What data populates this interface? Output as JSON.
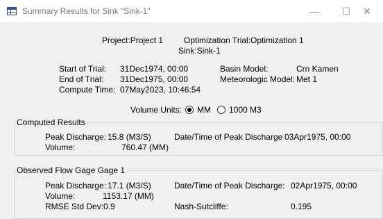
{
  "window": {
    "title": "Summary Results for Sink \"Sink-1\"",
    "minimize_glyph": "—",
    "maximize_glyph": "☐",
    "close_glyph": "✕"
  },
  "header": {
    "project_label": "Project:",
    "project_value": "Project 1",
    "trial_label": "Optimization Trial:",
    "trial_value": "Optimization 1",
    "sink_label": "Sink:",
    "sink_value": "Sink-1"
  },
  "info": {
    "start_label": "Start of Trial:",
    "start_value": "31Dec1974, 00:00",
    "end_label": "End of Trial:",
    "end_value": "31Dec1975, 00:00",
    "compute_label": "Compute Time:",
    "compute_value": "07May2023, 10:46:54",
    "basin_label": "Basin Model:",
    "basin_value": "Crn Kamen",
    "met_label": "Meteorologic Model:",
    "met_value": "Met 1"
  },
  "units": {
    "label": "Volume Units:",
    "options": [
      "MM",
      "1000 M3"
    ],
    "selected": "MM"
  },
  "computed": {
    "title": "Computed Results",
    "peak_label": "Peak Discharge:",
    "peak_value": "15.8 (M3/S)",
    "volume_label": "Volume:",
    "volume_value": "760.47 (MM)",
    "peak_time_label": "Date/Time of Peak Discharge",
    "peak_time_value": "03Apr1975, 00:00"
  },
  "observed": {
    "title": "Observed Flow Gage Gage 1",
    "peak_label": "Peak Discharge:",
    "peak_value": "17.1 (M3/S)",
    "volume_label": "Volume:",
    "volume_value": "1153.17 (MM)",
    "peak_time_label": "Date/Time of Peak Discharge:",
    "peak_time_value": "02Apr1975, 00:00",
    "rmse_label": "RMSE Std Dev:",
    "rmse_value": "0.9",
    "nash_label": "Nash-Sutcliffe:",
    "nash_value": "0.195"
  }
}
